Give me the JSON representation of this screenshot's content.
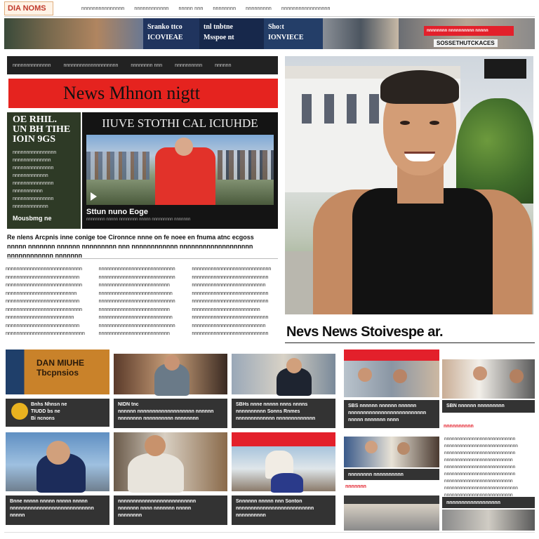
{
  "site": {
    "logo_text": "DIA NOMS",
    "nav": [
      "nnnnnnnnnnnnnnn",
      "nnnnnnnnnnnn",
      "nnnnn nnn",
      "nnnnnnnn",
      "nnnnnnnnn",
      "nnnnnnnnnnnnnnnnn"
    ]
  },
  "banner": {
    "cells": [
      "Sranko ttco\nICOVIEAE",
      "tnl tnbtne\nMsspoe nt",
      "Sho:t\nIONVIECE"
    ],
    "red_label": "nnnnnnnn nnnnnnnnnn nnnnn",
    "sub_label": "SOSSETHUTCKACES"
  },
  "section": {
    "darkbar": [
      "nnnnnnnnnnnnnn",
      "nnnnnnnnnnnnnnnnnnnn",
      "nnnnnnnn nnn",
      "nnnnnnnnnn",
      "nnnnnn"
    ],
    "red_title": "News Mhnon nigtt"
  },
  "sidecard": {
    "heading": "OE RHIL.\nUN BH TIHE\nIOIN 9GS",
    "body": "nnnnnnnnnnnnnnnn\nnnnnnnnnnnnnnn\nnnnnnnnnnnnnnnn\nnnnnnnnnnnnnn\nnnnnnnnnnnnnnnn\nnnnnnnnnnnn\nnnnnnnnnnnnnnnn\nnnnnnnnnnnnnn",
    "footer": "Mousbmg ne"
  },
  "video": {
    "title": "IIUVE STOTHI CAL ICIUHDE",
    "caption": "Sttun nuno Eoge",
    "subcaption": "nnnnnnnn nnnnn nnnnnnnn nnnnn nnnnnnnnn nnnnnnn"
  },
  "lead_headline": "Re nlens Arcpnis inne conige toe Cironnce nnne on fe noee en fnuma atnc ecgoss\nnnnnn nnnnnnn nnnnnn nnnnnnnnn nnn nnnnnnnnnnnn nnnnnnnnnnnnnnnnnnn nnnnnnnnnnnn nnnnnnn",
  "columns": [
    "nnnnnnnnnnnnnnnnnnnnnnnnnnnn\nnnnnnnnnnnnnnnnnnnnnnnnnnnn\nnnnnnnnnnnnnnnnnnnnnnnnnnnnn\nnnnnnnnnnnnnnnnnnnnnnnnnnn\nnnnnnnnnnnnnnnnnnnnnnnnnnnn\nnnnnnnnnnnnnnnnnnnnnnnnnnnnn\nnnnnnnnnnnnnnnnnnnnnnnnnn\nnnnnnnnnnnnnnnnnnnnnnnnnnnn\nnnnnnnnnnnnnnnnnnnnnnnnnnnnnn",
    "nnnnnnnnnnnnnnnnnnnnnnnnnnnn\nnnnnnnnnnnnnnnnnnnnnnnnnnnnn\nnnnnnnnnnnnnnnnnnnnnnnnnnn\nnnnnnnnnnnnnnnnnnnnnnnnnnnn\nnnnnnnnnnnnnnnnnnnnnnnnnnnnn\nnnnnnnnnnnnnnnnnnnnnnnnnnn\nnnnnnnnnnnnnnnnnnnnnnnnnnnn\nnnnnnnnnnnnnnnnnnnnnnnnnnnnn\nnnnnnnnnnnnnnnnnnnnnnnnnnn",
    "nnnnnnnnnnnnnnnnnnnnnnnnnnnnn\nnnnnnnnnnnnnnnnnnnnnnnnnnnnn\nnnnnnnnnnnnnnnnnnnnnnnnnnnn\nnnnnnnnnnnnnnnnnnnnnnnnnnnnn\nnnnnnnnnnnnnnnnnnnnnnnnnnnnn\nnnnnnnnnnnnnnnnnnnnnnnnnn\nnnnnnnnnnnnnnnnnnnnnnnnnnnnn\nnnnnnnnnnnnnnnnnnnnnnnnnnnn\nnnnnnnnnnnnnnnnnnnnnnnnnnnnn"
  ],
  "hero": {
    "title": "Nevs News Stoivespe ar."
  },
  "grid": {
    "row1": [
      {
        "img_text": "DAN MIUHE\nTbcpnsios",
        "caption": "Bnhs Nhnsn ne\nTIUDD bs ne\nBi ncnons"
      },
      {
        "caption": "NIDN tnc\nnnnnnn nnnnnnnnnnnnnnnnnnn nnnnnn\nnnnnnnnn nnnnnnnnnn nnnnnnnn"
      },
      {
        "caption": "SBHs nnne nnnnn nnns nnnns\nnnnnnnnnnn Sonns Rnmes\nnnnnnnnnnnnnn nnnnnnnnnnnnn"
      },
      {
        "caption": "SBS nnnnnn nnnnnn nnnnnn\nnnnnnnnnnnnnnnnnnnnnnnnnnn\nnnnnn nnnnnnn nnnn"
      },
      {
        "caption": "SBN nnnnnn nnnnnnnnn",
        "red_label": "nnnnnnnnnn",
        "text": "nnnnnnnnnnnnnnnnnnnnnnnnnnnn\nnnnnnnnnnnnnnnnnnnnnnnnnnnnnn\nnnnnnnnnnnnnnnnnnnnnnnnnnnnn\nnnnnnnnnnnnnnnnnnnnnnnnnnnn\nnnnnnnnnnnnnnnnnnnnnnnnnnnnn\nnnnnnnnnnnnnnnnnnnnnnnnnnnnn\nnnnnnnnnnnnnnnnnnnnnnnnnnnn\nnnnnnnnnnnnnnnnnnnnnnnnnnnnnn\nnnnnnnnnnnnnnnnnnnnnnnnnnnn"
      }
    ],
    "row2": [
      {
        "caption": "Bnne nnnnn nnnnn nnnnn nnnnn\nnnnnnnnnnnnnnnnnnnnnnnnnnnnn\nnnnnn"
      },
      {
        "caption": "nnnnnnnnnnnnnnnnnnnnnnnnnn\nnnnnnnn nnnn nnnnnnn nnnnn\nnnnnnnnn"
      },
      {
        "caption": "Snnnnnn nnnnn nnn Sonton\nnnnnnnnnnnnnnnnnnnnnnnnnnn\nnnnnnnnnnn"
      },
      {
        "caption": "nnnnnnnn nnnnnnnnnn",
        "red_label": "nnnnnnn"
      },
      {
        "caption": "nnnnnnnnnnnnnnnnnn"
      }
    ]
  }
}
